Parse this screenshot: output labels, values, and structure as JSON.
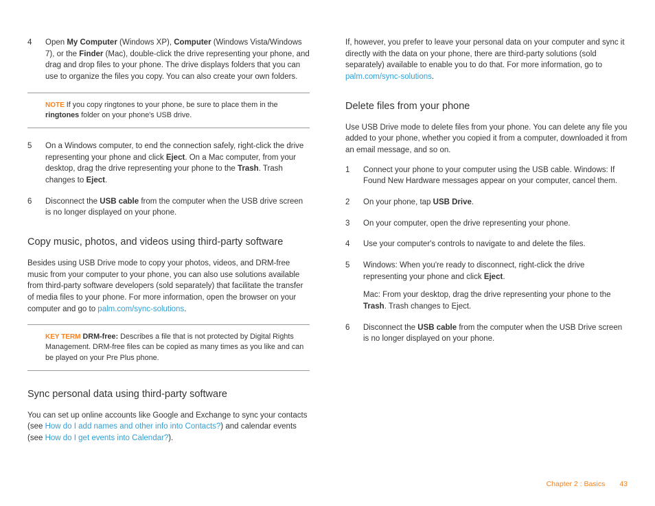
{
  "left": {
    "step4_num": "4",
    "step4_a": "Open ",
    "step4_b1": "My Computer",
    "step4_c": " (Windows XP), ",
    "step4_b2": "Computer",
    "step4_d": " (Windows Vista/Windows 7), or the ",
    "step4_b3": "Finder",
    "step4_e": " (Mac), double-click the drive representing your phone, and drag and drop files to your phone. The drive displays folders that you can use to organize the files you copy. You can also create your own folders.",
    "note_label": "NOTE",
    "note_a": "  If you copy ringtones to your phone, be sure to place them in the ",
    "note_b": "ringtones",
    "note_c": " folder on your phone's USB drive.",
    "step5_num": "5",
    "step5_a": "On a Windows computer, to end the connection safely, right-click the drive representing your phone and click ",
    "step5_b1": "Eject",
    "step5_c": ". On a Mac computer, from your desktop, drag the drive representing your phone to the ",
    "step5_b2": "Trash",
    "step5_d": ". Trash changes to ",
    "step5_b3": "Eject",
    "step5_e": ".",
    "step6_num": "6",
    "step6_a": "Disconnect the ",
    "step6_b": "USB cable",
    "step6_c": " from the computer when the USB drive screen is no longer displayed on your phone.",
    "h_copy": "Copy music, photos, and videos using third-party software",
    "copy_a": "Besides using USB Drive mode to copy your photos, videos, and DRM-free music from your computer to your phone, you can also use solutions available from third-party software developers (sold separately) that facilitate the transfer of media files to your phone. For more information, open the browser on your computer and go to ",
    "copy_link": "palm.com/sync-solutions",
    "copy_b": ".",
    "kt_label": "KEY TERM",
    "kt_b": "DRM-free:",
    "kt_a": " Describes a file that is not protected by Digital Rights Management. DRM-free  files can be copied as many times as you like and can be played on your Pre Plus phone.",
    "h_sync": "Sync personal data using third-party software",
    "sync_a": "You can set up online accounts like Google and Exchange to sync your contacts (see ",
    "sync_link1": "How do I add names and other info into Contacts?",
    "sync_b": ") and calendar events (see ",
    "sync_link2": "How do I get events into Calendar?",
    "sync_c": ")."
  },
  "right": {
    "intro_a": "If, however, you prefer to leave your personal data on your computer and sync it directly with the data on your phone, there are third-party solutions (sold separately) available to enable you to do that. For more information, go to ",
    "intro_link": "palm.com/sync-solutions",
    "intro_b": ".",
    "h_del": "Delete files from your phone",
    "del_intro": "Use USB Drive mode to delete files from your phone. You can delete any file you added to your phone, whether you copied it from a computer, downloaded it from an email message, and so on.",
    "s1_num": "1",
    "s1": "Connect your phone to your computer using the USB cable. Windows: If Found New Hardware messages appear on your computer, cancel them.",
    "s2_num": "2",
    "s2_a": "On your phone, tap ",
    "s2_b": "USB Drive",
    "s2_c": ".",
    "s3_num": "3",
    "s3": "On your computer, open the drive representing your phone.",
    "s4_num": "4",
    "s4": "Use your computer's controls to navigate to and delete the files.",
    "s5_num": "5",
    "s5_a": "Windows: When you're ready to disconnect, right-click the drive representing your phone and click ",
    "s5_b": "Eject",
    "s5_c": ".",
    "s5_mac_a": "Mac: From your desktop, drag the drive representing your phone to the ",
    "s5_mac_b": "Trash",
    "s5_mac_c": ". Trash changes to Eject.",
    "s6_num": "6",
    "s6_a": "Disconnect the ",
    "s6_b": "USB cable",
    "s6_c": " from the computer when the USB Drive screen is no longer displayed on your phone."
  },
  "footer": {
    "chapter": "Chapter 2  :  Basics",
    "page": "43"
  }
}
